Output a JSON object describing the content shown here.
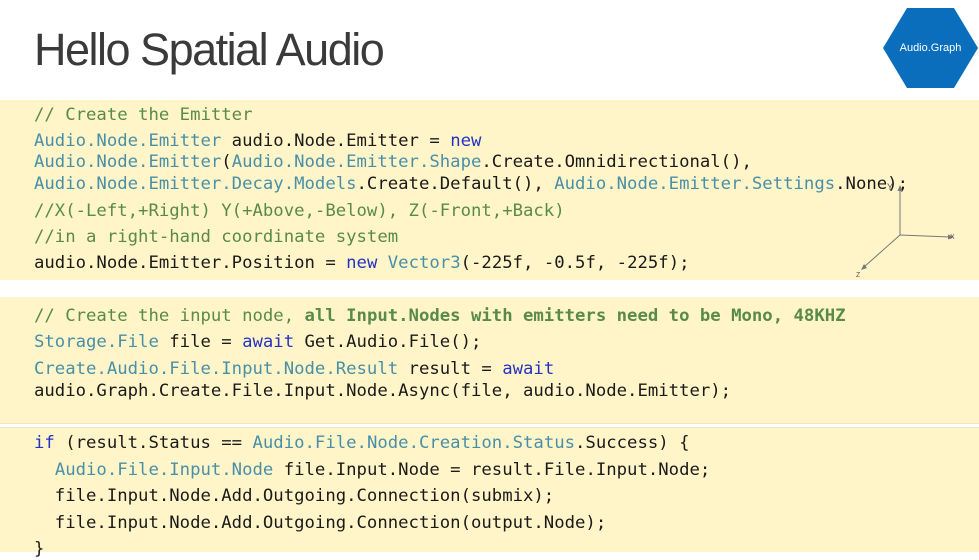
{
  "slide": {
    "title": "Hello Spatial Audio",
    "badge": "Audio.Graph",
    "badge_color": "#0a6ebd"
  },
  "code": {
    "block1": [
      "// Create the Emitter",
      [
        "Audio.Node.Emitter",
        " audio.Node.Emitter = ",
        "new"
      ],
      [
        "Audio.Node.Emitter",
        "(",
        "Audio.Node.Emitter.Shape",
        ".Create.Omnidirectional(),"
      ],
      [
        "Audio.Node.Emitter.Decay.Models",
        ".Create.Default(), ",
        "Audio.Node.Emitter.Settings",
        ".None);"
      ],
      "//X(-Left,+Right) Y(+Above,-Below), Z(-Front,+Back)",
      "//in a right-hand coordinate system",
      [
        "audio.Node.Emitter.Position = ",
        "new",
        " ",
        "Vector3",
        "(-225f, -0.5f, -225f);"
      ]
    ],
    "block2": [
      [
        "// Create the input node, ",
        "all Input.Nodes with emitters need to be Mono, 48KHZ"
      ],
      [
        "Storage.File",
        " file = ",
        "await",
        " Get.Audio.File();"
      ],
      [
        "Create.Audio.File.Input.Node.Result",
        " result = ",
        "await"
      ],
      "audio.Graph.Create.File.Input.Node.Async(file, audio.Node.Emitter);"
    ],
    "block3": [
      [
        "if",
        " (result.Status == ",
        "Audio.File.Node.Creation.Status",
        ".Success) {"
      ],
      [
        "  ",
        "Audio.File.Input.Node",
        " file.Input.Node = result.File.Input.Node;"
      ],
      "  file.Input.Node.Add.Outgoing.Connection(submix);",
      "  file.Input.Node.Add.Outgoing.Connection(output.Node);",
      "}"
    ]
  },
  "axes": {
    "y": "Y",
    "x": "X",
    "z": "Z"
  }
}
